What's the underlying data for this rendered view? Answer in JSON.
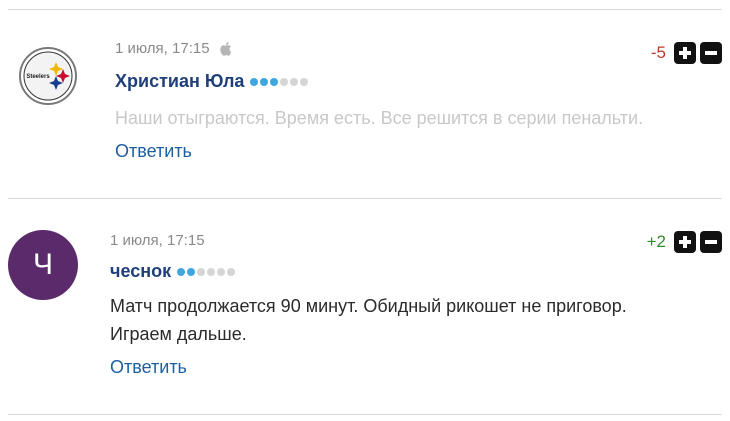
{
  "comments": [
    {
      "date": "1 июля, 17:15",
      "device_icon": "apple-icon",
      "author": "Христиан Юла",
      "avatar_type": "steelers-logo",
      "avatar_text": "Steelers",
      "rating_dots": {
        "filled": 3,
        "total": 6
      },
      "text": "Наши отыграются. Время есть. Все решится в серии пенальти.",
      "text_color": "#c8c8c8",
      "reply_label": "Ответить",
      "score": "-5",
      "score_color": "#c0392b"
    },
    {
      "date": "1 июля, 17:15",
      "author": "чеснок",
      "avatar_type": "letter",
      "avatar_letter": "Ч",
      "avatar_color": "#5b2a6b",
      "rating_dots": {
        "filled": 2,
        "total": 6
      },
      "text_lines": [
        "Матч продолжается 90 минут. Обидный рикошет не приговор.",
        "Играем дальше."
      ],
      "text_color": "#2b2b2b",
      "reply_label": "Ответить",
      "score": "+2",
      "score_color": "#2e8b2e"
    }
  ],
  "colors": {
    "dot_filled": "#3fa7e0",
    "dot_empty": "#d5d5d5",
    "author": "#1f3f7a",
    "reply": "#1f5fa0",
    "vote_button": "#111111"
  },
  "icons": {
    "upvote": "plus-icon",
    "downvote": "minus-icon"
  }
}
